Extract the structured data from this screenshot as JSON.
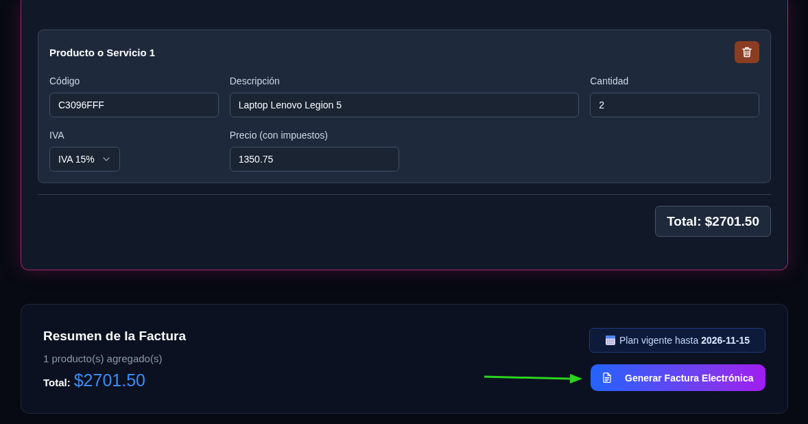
{
  "products": [
    {
      "title": "Producto o Servicio 1",
      "code": {
        "label": "Código",
        "value": "C3096FFF"
      },
      "description": {
        "label": "Descripción",
        "value": "Laptop Lenovo Legion 5"
      },
      "quantity": {
        "label": "Cantidad",
        "value": "2"
      },
      "tax": {
        "label": "IVA",
        "value": "IVA 15%"
      },
      "price": {
        "label": "Precio (con impuestos)",
        "value": "1350.75"
      }
    }
  ],
  "products_total": "Total: $2701.50",
  "summary": {
    "title": "Resumen de la Factura",
    "count": "1 producto(s) agregado(s)",
    "total_label": "Total:",
    "total_value": "$2701.50",
    "plan": "Plan vigente hasta **2026-11-15**",
    "generate_button": "Generar Factura Electrónica"
  }
}
